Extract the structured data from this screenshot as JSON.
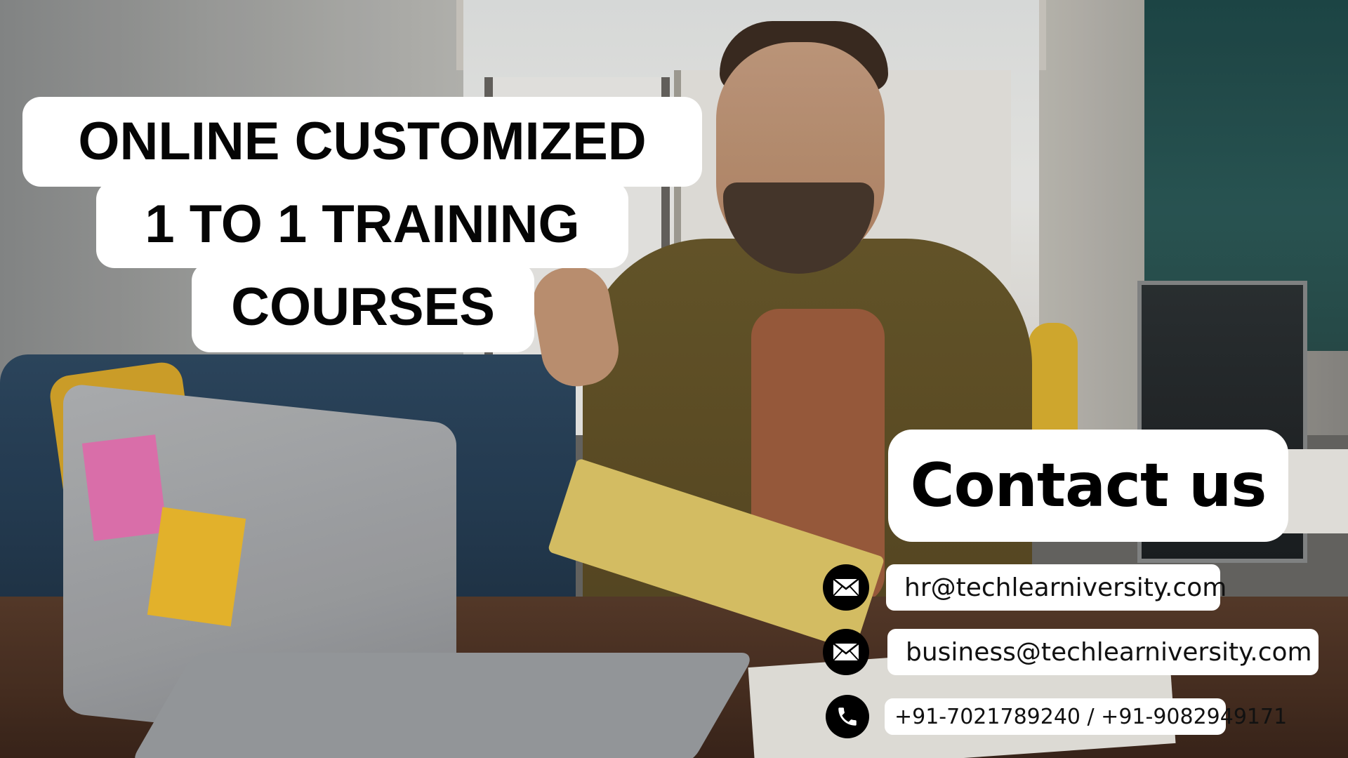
{
  "headline": {
    "line1": "ONLINE CUSTOMIZED",
    "line2": "1 TO 1 TRAINING",
    "line3": "COURSES"
  },
  "contact": {
    "heading": "Contact us",
    "email_primary": "hr@techlearniversity.com",
    "email_secondary": "business@techlearniversity.com",
    "phone": "+91-7021789240 / +91-9082949171",
    "email_icon": "envelope-icon",
    "phone_icon": "phone-icon"
  },
  "colors": {
    "pill_background": "#ffffff",
    "text": "#000000",
    "icon_background": "#000000"
  }
}
